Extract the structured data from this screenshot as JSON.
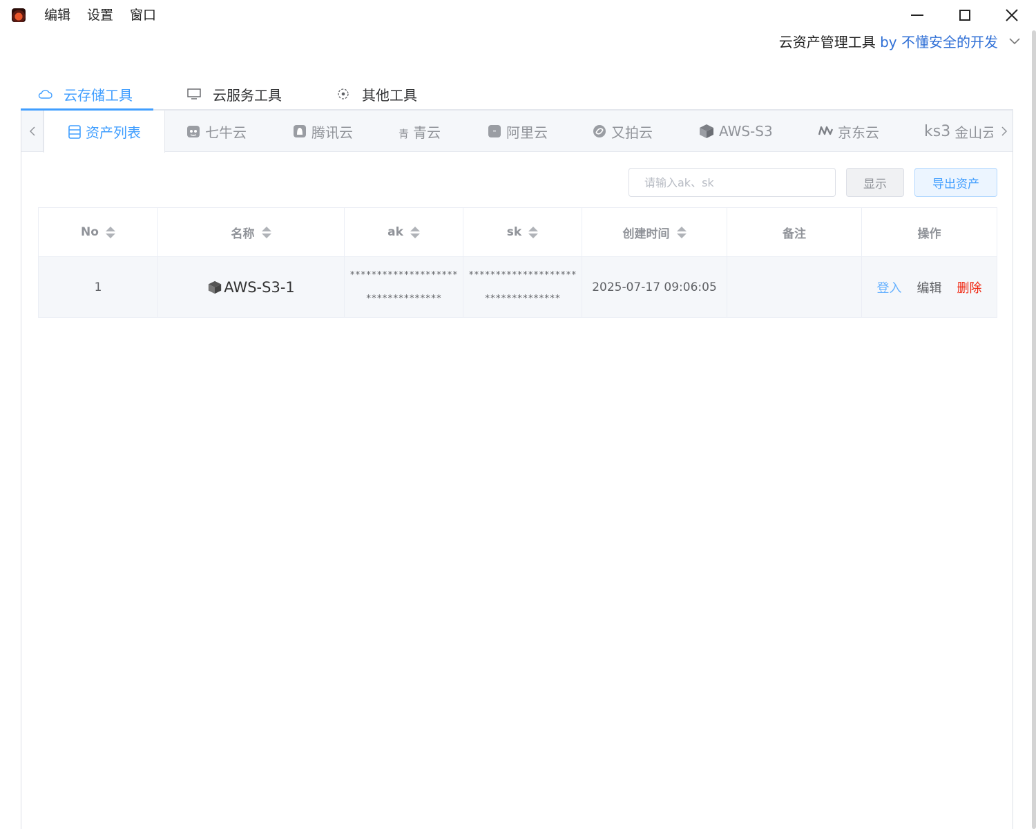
{
  "menu": [
    "编辑",
    "设置",
    "窗口"
  ],
  "brand": {
    "title": "云资产管理工具",
    "by": "by 不懂安全的开发"
  },
  "top_tabs": [
    {
      "label": "云存储工具",
      "icon": "cloud-icon"
    },
    {
      "label": "云服务工具",
      "icon": "monitor-icon"
    },
    {
      "label": "其他工具",
      "icon": "target-icon"
    }
  ],
  "sub_tabs": [
    {
      "label": "资产列表",
      "icon": "database-icon"
    },
    {
      "label": "七牛云",
      "icon": "qiniu-icon"
    },
    {
      "label": "腾讯云",
      "icon": "tencent-icon"
    },
    {
      "label": "青云",
      "icon": "qingcloud-icon",
      "mark": "青"
    },
    {
      "label": "阿里云",
      "icon": "aliyun-icon"
    },
    {
      "label": "又拍云",
      "icon": "upyun-icon"
    },
    {
      "label": "AWS-S3",
      "icon": "aws-cube-icon"
    },
    {
      "label": "京东云",
      "icon": "jdcloud-icon"
    },
    {
      "label": "金山云",
      "icon": "ksyun-icon",
      "mark": "ks3"
    }
  ],
  "toolbar": {
    "search_placeholder": "请输入ak、sk",
    "show_label": "显示",
    "export_label": "导出资产"
  },
  "table": {
    "headers": [
      "No",
      "名称",
      "ak",
      "sk",
      "创建时间",
      "备注",
      "操作"
    ],
    "rows": [
      {
        "no": "1",
        "name": "AWS-S3-1",
        "ak_line1": "********************",
        "ak_line2": "**************",
        "sk_line1": "********************",
        "sk_line2": "**************",
        "created": "2025-07-17 09:06:05",
        "note": "",
        "ops": {
          "login": "登入",
          "edit": "编辑",
          "delete": "删除"
        }
      }
    ]
  },
  "colors": {
    "accent": "#409eff",
    "danger": "#f0230c",
    "brand_link": "#2f6fd6"
  }
}
